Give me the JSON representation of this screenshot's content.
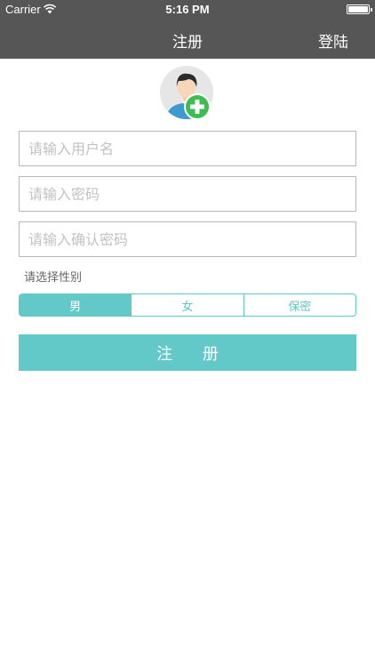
{
  "status_bar": {
    "carrier": "Carrier",
    "time": "5:16 PM"
  },
  "nav": {
    "title": "注册",
    "right_button": "登陆"
  },
  "form": {
    "username_placeholder": "请输入用户名",
    "password_placeholder": "请输入密码",
    "confirm_placeholder": "请输入确认密码",
    "gender_label": "请选择性别",
    "gender_options": [
      "男",
      "女",
      "保密"
    ],
    "selected_gender": "男",
    "submit_label": "注 册"
  },
  "colors": {
    "nav_bg": "#565656",
    "accent": "#63c8c8",
    "add_badge": "#3dbd4f"
  },
  "icons": {
    "avatar": "add-user-avatar-icon",
    "wifi": "wifi-icon",
    "battery": "battery-icon"
  }
}
